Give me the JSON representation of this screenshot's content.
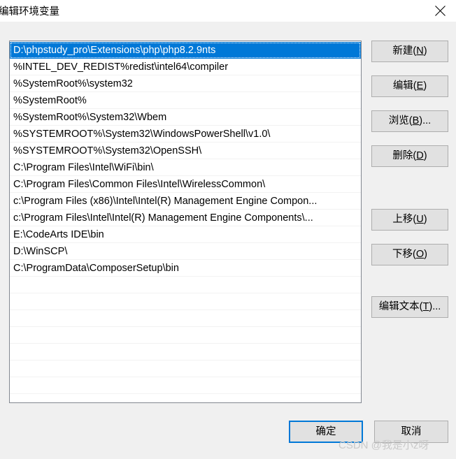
{
  "window": {
    "title": "编辑环境变量",
    "close_label": "✕",
    "close_icon": "close-icon"
  },
  "path_list": {
    "selected_index": 0,
    "row_count_total": 21,
    "items": [
      "D:\\phpstudy_pro\\Extensions\\php\\php8.2.9nts",
      "%INTEL_DEV_REDIST%redist\\intel64\\compiler",
      "%SystemRoot%\\system32",
      "%SystemRoot%",
      "%SystemRoot%\\System32\\Wbem",
      "%SYSTEMROOT%\\System32\\WindowsPowerShell\\v1.0\\",
      "%SYSTEMROOT%\\System32\\OpenSSH\\",
      "C:\\Program Files\\Intel\\WiFi\\bin\\",
      "C:\\Program Files\\Common Files\\Intel\\WirelessCommon\\",
      "c:\\Program Files (x86)\\Intel\\Intel(R) Management Engine Compon...",
      "c:\\Program Files\\Intel\\Intel(R) Management Engine Components\\...",
      "E:\\CodeArts IDE\\bin",
      "D:\\WinSCP\\",
      "C:\\ProgramData\\ComposerSetup\\bin"
    ]
  },
  "side_buttons": {
    "new": {
      "text": "新建(N)",
      "prefix": "新建(",
      "accel": "N",
      "suffix": ")"
    },
    "edit": {
      "text": "编辑(E)",
      "prefix": "编辑(",
      "accel": "E",
      "suffix": ")"
    },
    "browse": {
      "text": "浏览(B)...",
      "prefix": "浏览(",
      "accel": "B",
      "suffix": ")..."
    },
    "delete": {
      "text": "删除(D)",
      "prefix": "删除(",
      "accel": "D",
      "suffix": ")"
    },
    "move_up": {
      "text": "上移(U)",
      "prefix": "上移(",
      "accel": "U",
      "suffix": ")"
    },
    "move_down": {
      "text": "下移(O)",
      "prefix": "下移(",
      "accel": "O",
      "suffix": ")"
    },
    "edit_text": {
      "text": "编辑文本(T)...",
      "prefix": "编辑文本(",
      "accel": "T",
      "suffix": ")..."
    }
  },
  "bottom_buttons": {
    "ok": "确定",
    "cancel": "取消"
  },
  "watermark": "CSDN @我是小z呀",
  "colors": {
    "selection": "#0078d7",
    "dialog_background": "#f0f0f0",
    "button_face": "#e1e1e1",
    "button_border": "#adadad",
    "listbox_border": "#828790",
    "watermark_text": "#c9c9c9"
  }
}
